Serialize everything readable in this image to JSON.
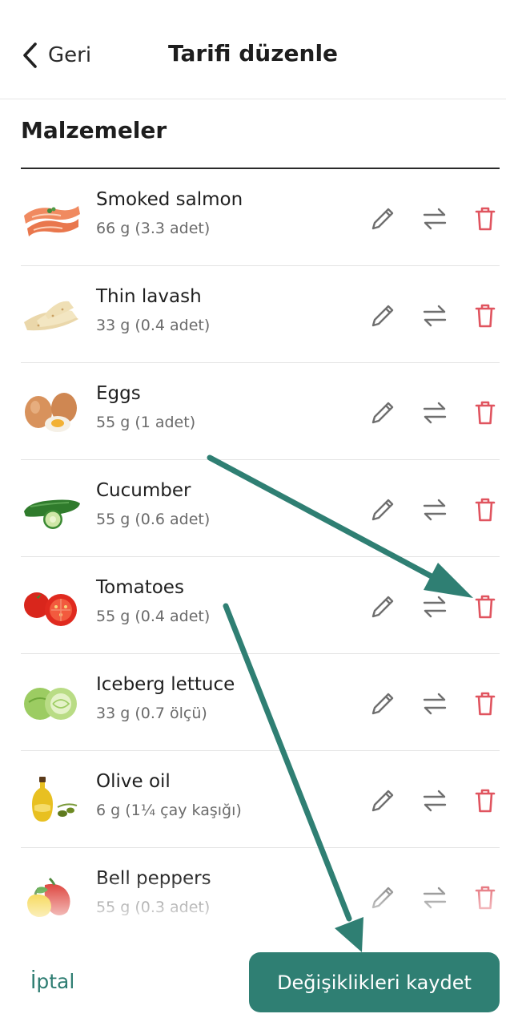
{
  "header": {
    "back_label": "Geri",
    "title": "Tarifi düzenle"
  },
  "section": {
    "title": "Malzemeler"
  },
  "ingredients": [
    {
      "name": "Smoked salmon",
      "amount": "66 g (3.3 adet)",
      "image": "smoked-salmon"
    },
    {
      "name": "Thin lavash",
      "amount": "33 g (0.4 adet)",
      "image": "lavash"
    },
    {
      "name": "Eggs",
      "amount": "55 g (1 adet)",
      "image": "eggs"
    },
    {
      "name": "Cucumber",
      "amount": "55 g (0.6 adet)",
      "image": "cucumber"
    },
    {
      "name": "Tomatoes",
      "amount": "55 g (0.4 adet)",
      "image": "tomatoes"
    },
    {
      "name": "Iceberg lettuce",
      "amount": "33 g (0.7 ölçü)",
      "image": "lettuce"
    },
    {
      "name": "Olive oil",
      "amount": "6 g (1¼ çay kaşığı)",
      "image": "olive-oil"
    },
    {
      "name": "Bell peppers",
      "amount": "55 g (0.3 adet)",
      "image": "bell-peppers"
    }
  ],
  "row_actions": {
    "edit_icon": "pencil-icon",
    "swap_icon": "swap-arrows-icon",
    "delete_icon": "trash-icon"
  },
  "footer": {
    "cancel_label": "İptal",
    "save_label": "Değişiklikleri kaydet"
  },
  "colors": {
    "accent": "#2f7f73",
    "delete": "#e0545f",
    "icon_gray": "#6f6f6f",
    "annotation_arrow": "#2f7f73"
  }
}
